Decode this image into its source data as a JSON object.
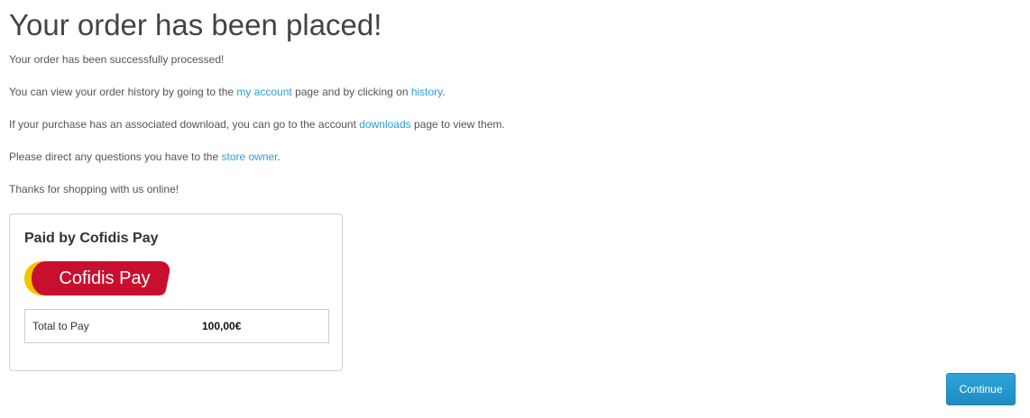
{
  "page": {
    "title": "Your order has been placed!"
  },
  "messages": {
    "processed": "Your order has been successfully processed!",
    "history_prefix": "You can view your order history by going to the ",
    "my_account_link": "my account",
    "history_middle": " page and by clicking on ",
    "history_link": "history",
    "history_suffix": ".",
    "download_prefix": "If your purchase has an associated download, you can go to the account ",
    "downloads_link": "downloads",
    "download_suffix": " page to view them.",
    "questions_prefix": "Please direct any questions you have to the ",
    "store_owner_link": "store owner",
    "questions_suffix": ".",
    "thanks": "Thanks for shopping with us online!"
  },
  "payment_panel": {
    "title": "Paid by Cofidis Pay",
    "logo_text": "Cofidis Pay",
    "logo_colors": {
      "red": "#c8102e",
      "yellow": "#f5c400"
    },
    "total_label": "Total to Pay",
    "total_value": "100,00€"
  },
  "actions": {
    "continue_label": "Continue"
  },
  "colors": {
    "link": "#2a9fd6",
    "button": "#2a9fd6",
    "text": "#555555",
    "heading": "#444444"
  }
}
